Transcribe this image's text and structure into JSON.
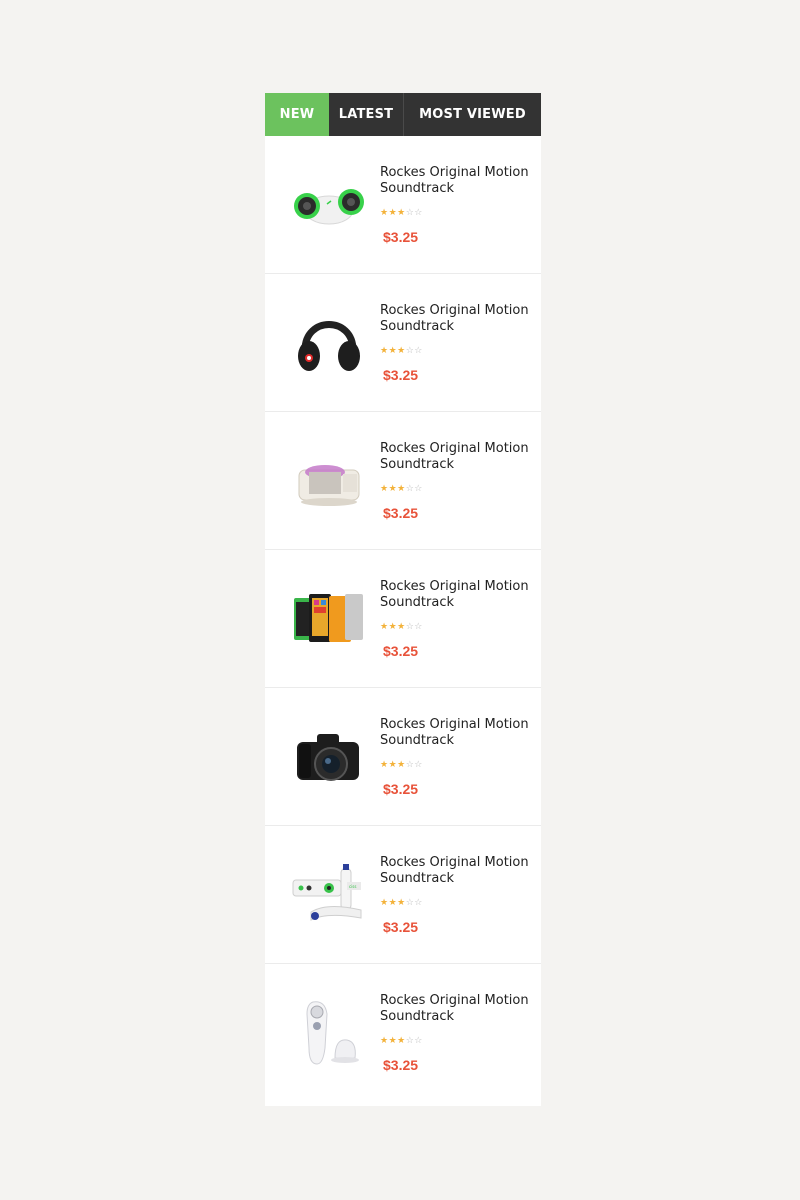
{
  "tabs": [
    {
      "label": "NEW",
      "active": true
    },
    {
      "label": "LATEST",
      "active": false
    },
    {
      "label": "MOST VIEWED",
      "active": false
    }
  ],
  "products": [
    {
      "title": "Rockes Original Motion Soundtrack",
      "rating": 3,
      "rating_max": 5,
      "price": "$3.25",
      "image": "speaker-image"
    },
    {
      "title": "Rockes Original Motion Soundtrack",
      "rating": 3,
      "rating_max": 5,
      "price": "$3.25",
      "image": "headphones-image"
    },
    {
      "title": "Rockes Original Motion Soundtrack",
      "rating": 3,
      "rating_max": 5,
      "price": "$3.25",
      "image": "mixer-image"
    },
    {
      "title": "Rockes Original Motion Soundtrack",
      "rating": 3,
      "rating_max": 5,
      "price": "$3.25",
      "image": "phones-image"
    },
    {
      "title": "Rockes Original Motion Soundtrack",
      "rating": 3,
      "rating_max": 5,
      "price": "$3.25",
      "image": "camera-image"
    },
    {
      "title": "Rockes Original Motion Soundtrack",
      "rating": 3,
      "rating_max": 5,
      "price": "$3.25",
      "image": "game-controller-image"
    },
    {
      "title": "Rockes Original Motion Soundtrack",
      "rating": 3,
      "rating_max": 5,
      "price": "$3.25",
      "image": "face-brush-image"
    }
  ],
  "colors": {
    "accent": "#6cc25e",
    "tab_bar": "#333333",
    "price": "#e8533a",
    "star": "#f3b23a",
    "page_bg": "#f4f3f1"
  }
}
